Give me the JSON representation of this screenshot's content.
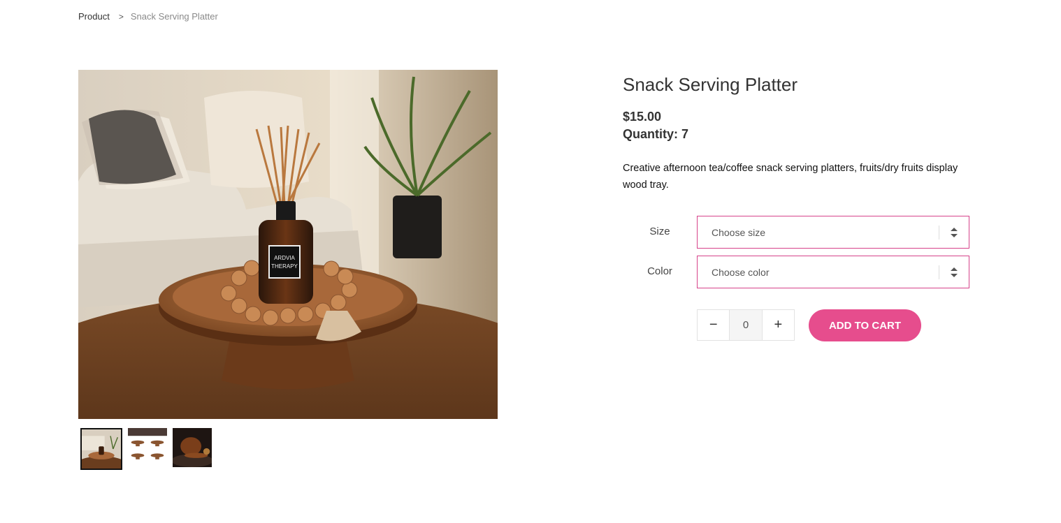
{
  "breadcrumb": {
    "root": "Product",
    "separator": ">",
    "current": "Snack Serving Platter"
  },
  "product": {
    "title": "Snack Serving Platter",
    "price": "$15.00",
    "quantity": "Quantity: 7",
    "description": "Creative afternoon tea/coffee snack serving platters, fruits/dry fruits display wood tray.",
    "image_label_line1": "ARDVIA",
    "image_label_line2": "THERAPY"
  },
  "options": {
    "size": {
      "label": "Size",
      "placeholder": "Choose size"
    },
    "color": {
      "label": "Color",
      "placeholder": "Choose color"
    }
  },
  "cart": {
    "minus": "−",
    "plus": "+",
    "qty_value": "0",
    "add_label": "ADD TO CART"
  },
  "thumbnails": [
    "main-photo",
    "four-platters",
    "dark-platter"
  ],
  "colors": {
    "accent": "#e64d8d",
    "select_border": "#d6428a"
  }
}
